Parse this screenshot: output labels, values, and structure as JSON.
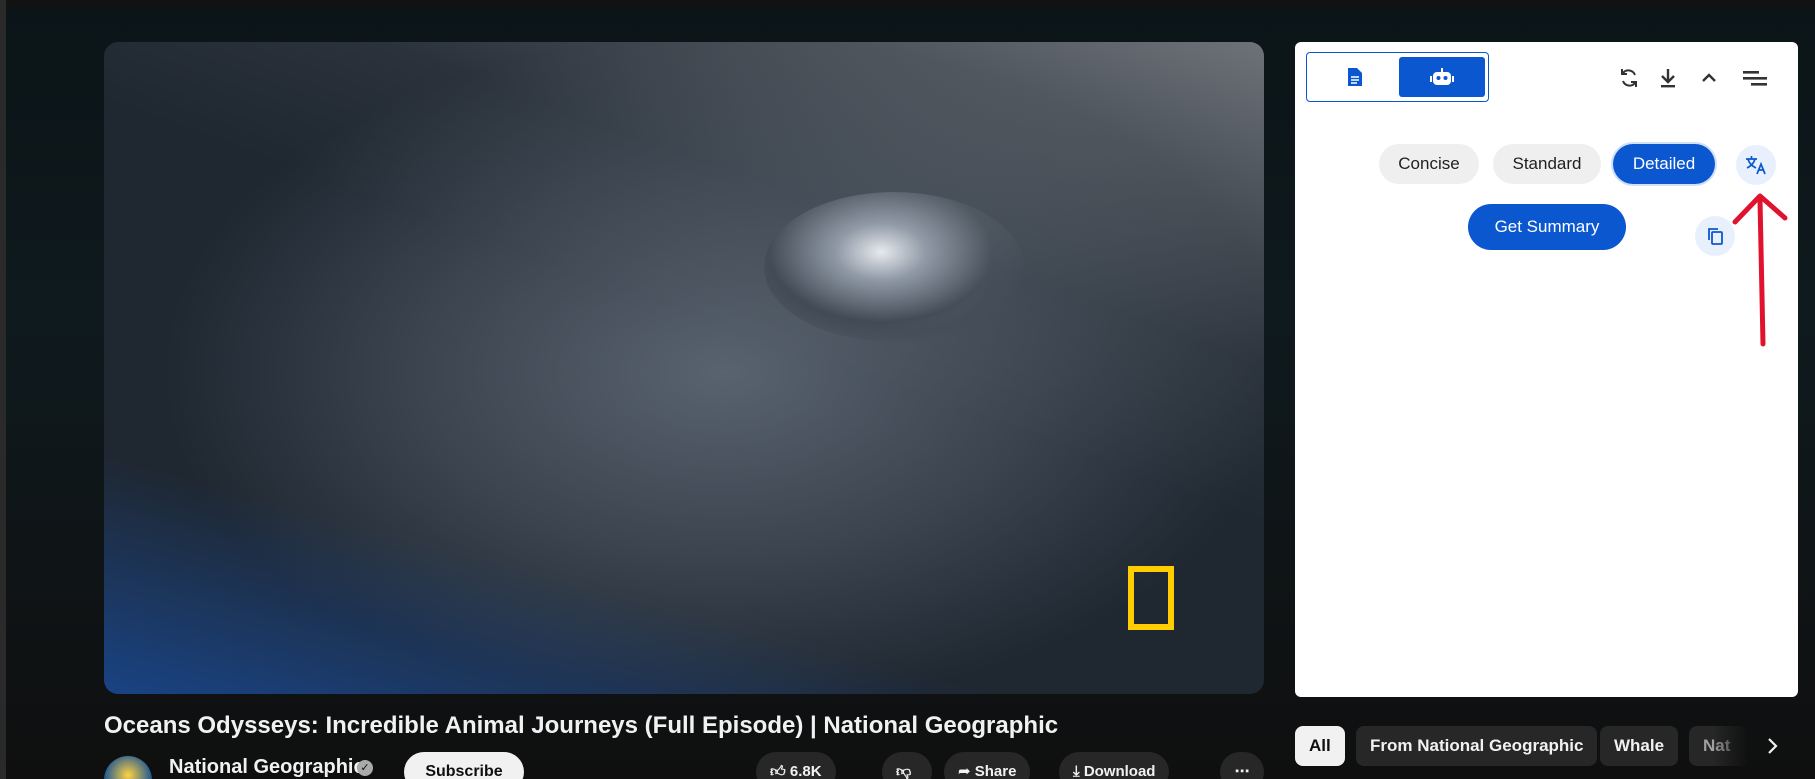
{
  "video": {
    "title": "Oceans Odysseys: Incredible Animal Journeys (Full Episode) | National Geographic",
    "channel": "National Geographic",
    "subscribe_label": "Subscribe",
    "like_count": "6.8K",
    "share_label": "Share",
    "download_label": "Download"
  },
  "summary_panel": {
    "modes": [
      "transcript-icon",
      "robot-icon"
    ],
    "toolbar_icons": [
      "refresh-icon",
      "download-icon",
      "chevron-up-icon",
      "menu-icon"
    ],
    "length_options": [
      {
        "label": "Concise",
        "selected": false
      },
      {
        "label": "Standard",
        "selected": false
      },
      {
        "label": "Detailed",
        "selected": true
      }
    ],
    "get_summary_label": "Get Summary",
    "accent_color": "#0b57d0"
  },
  "filter_chips": [
    "All",
    "From National Geographic",
    "Whale",
    "Nat"
  ]
}
